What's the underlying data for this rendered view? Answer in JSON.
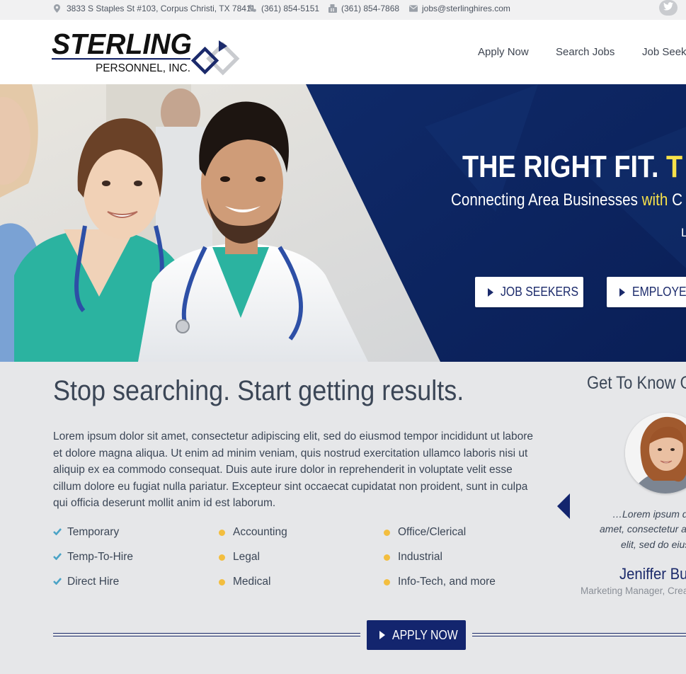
{
  "topbar": {
    "address": "3833 S Staples St #103, Corpus Christi, TX 78411",
    "phone": "(361) 854-5151",
    "fax": "(361) 854-7868",
    "email": "jobs@sterlinghires.com"
  },
  "brand": {
    "name": "STERLING",
    "sub": "PERSONNEL, INC.",
    "navy": "#1b2a6b",
    "yellow": "#f7e14a",
    "bullet": "#f3be3f",
    "check": "#4aa3c6"
  },
  "nav": {
    "apply": "Apply Now",
    "search": "Search Jobs",
    "seekers": "Job Seek"
  },
  "hero": {
    "title_main": "THE RIGHT FIT.",
    "title_hl": "T",
    "sub_main": "Connecting Area Businesses ",
    "sub_with": "with",
    "sub_end": " C",
    "line3": "L",
    "btn_seekers": "JOB SEEKERS",
    "btn_employers": "EMPLOYER"
  },
  "main": {
    "headline": "Stop searching. Start getting results.",
    "body": "Lorem ipsum dolor sit amet, consectetur adipiscing elit, sed do eiusmod tempor incididunt ut labore et dolore magna aliqua. Ut enim ad minim veniam, quis nostrud exercitation ullamco laboris nisi ut aliquip ex ea commodo consequat. Duis aute irure dolor in reprehenderit in voluptate velit esse cillum dolore eu fugiat nulla pariatur. Excepteur sint occaecat cupidatat non proident, sunt in culpa qui officia deserunt mollit anim id est laborum.",
    "services": {
      "col1": [
        "Temporary",
        "Temp-To-Hire",
        "Direct Hire"
      ],
      "col2": [
        "Accounting",
        "Legal",
        "Medical"
      ],
      "col3": [
        "Office/Clerical",
        "Industrial",
        "Info-Tech, and more"
      ]
    },
    "apply_button": "APPLY NOW"
  },
  "testimonial": {
    "heading": "Get To Know O",
    "quote_lines": [
      "…Lorem ipsum d",
      "amet, consectetur a",
      "elit, sed do eius"
    ],
    "name": "Jeniffer Bu",
    "role": "Marketing Manager, Crea"
  }
}
